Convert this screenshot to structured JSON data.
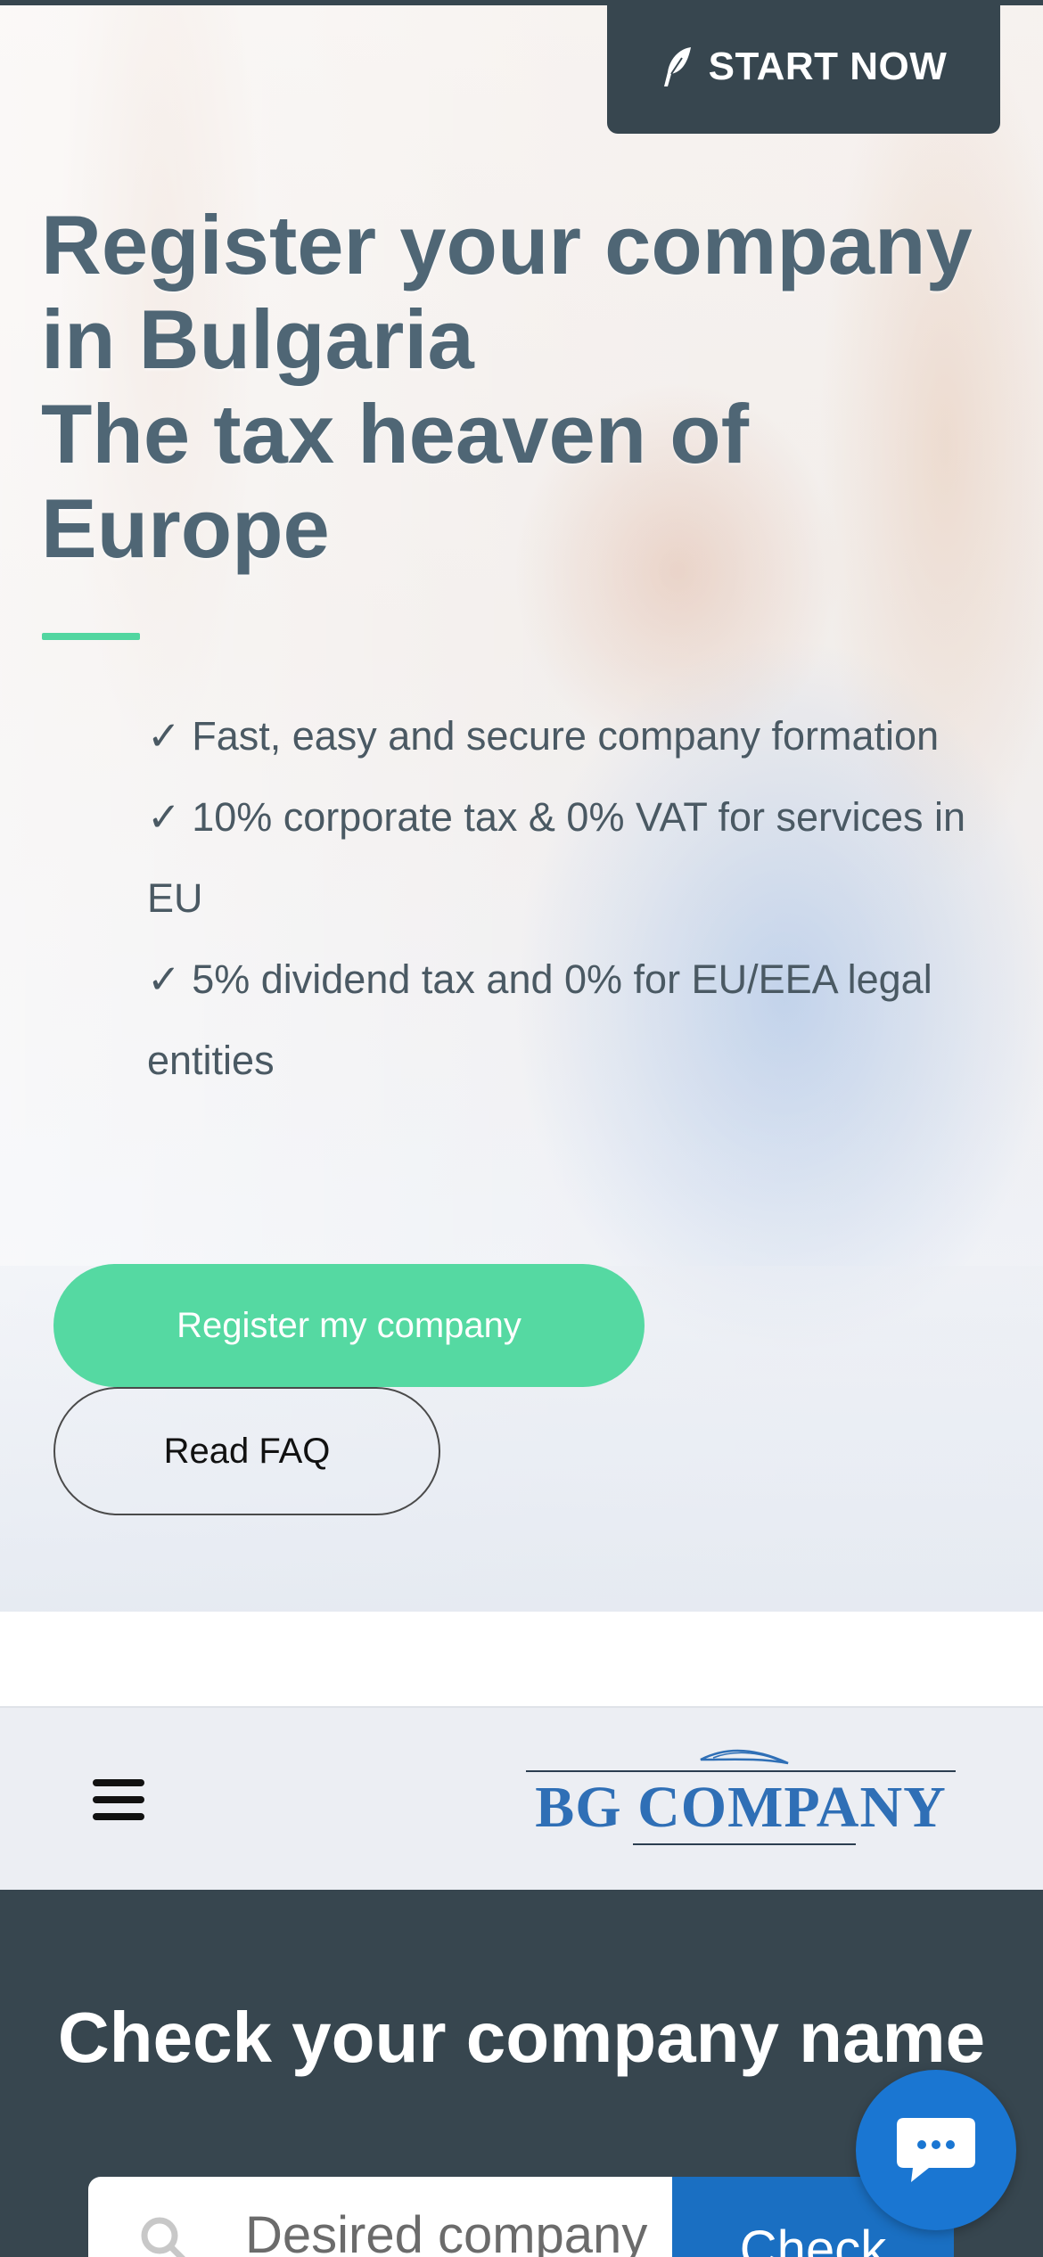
{
  "header": {
    "start_button_label": "START NOW"
  },
  "hero": {
    "title_line1": "Register your company",
    "title_line2": "in Bulgaria",
    "title_line3": "The tax heaven of",
    "title_line4": "Europe",
    "features": [
      "✓ Fast, easy and secure company formation",
      "✓ 10% corporate tax & 0% VAT for services in EU",
      "✓ 5% dividend tax and 0% for EU/EEA legal entities"
    ],
    "register_button_label": "Register my company",
    "faq_button_label": "Read FAQ"
  },
  "navbar": {
    "logo_text": "BG COMPANY"
  },
  "check_section": {
    "title": "Check your company name",
    "search_placeholder": "Desired company name",
    "check_button_label": "Check"
  },
  "colors": {
    "dark": "#37464f",
    "accent_green": "#55d9a2",
    "brand_blue": "#2f6fb6",
    "button_blue": "#1a6fc2"
  }
}
